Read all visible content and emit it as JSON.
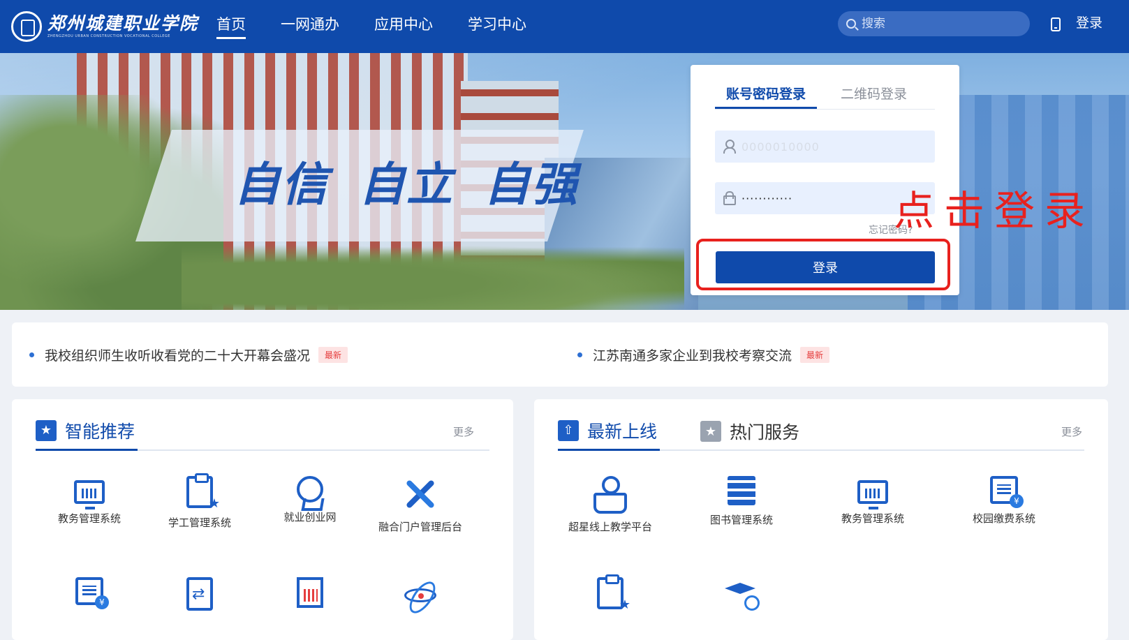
{
  "header": {
    "logo_cn": "郑州城建职业学院",
    "logo_en": "ZHENGZHOU URBAN CONSTRUCTION VOCATIONAL COLLEGE",
    "nav": [
      "首页",
      "一网通办",
      "应用中心",
      "学习中心"
    ],
    "active_nav": "首页",
    "search_placeholder": "搜索",
    "login_label": "登录"
  },
  "banner": {
    "slogan": "自信 自立 自强"
  },
  "login": {
    "tab_account": "账号密码登录",
    "tab_qrcode": "二维码登录",
    "username_value": "0000010000",
    "password_value": "············",
    "forgot": "忘记密码?",
    "submit": "登录",
    "annotation": "点击登录"
  },
  "news": [
    {
      "title": "我校组织师生收听收看党的二十大开幕会盛况",
      "badge": "最新"
    },
    {
      "title": "江苏南通多家企业到我校考察交流",
      "badge": "最新"
    }
  ],
  "left_panel": {
    "tab": "智能推荐",
    "more": "更多",
    "items": [
      "教务管理系统",
      "学工管理系统",
      "就业创业网",
      "融合门户管理后台",
      "",
      "",
      "",
      ""
    ]
  },
  "right_panel": {
    "tab_new": "最新上线",
    "tab_hot": "热门服务",
    "more": "更多",
    "items": [
      "超星线上教学平台",
      "图书管理系统",
      "教务管理系统",
      "校园缴费系统",
      "",
      ""
    ]
  },
  "colors": {
    "brand": "#0f4aab",
    "annotation": "#e8211e",
    "badge": "#e53d3d"
  }
}
